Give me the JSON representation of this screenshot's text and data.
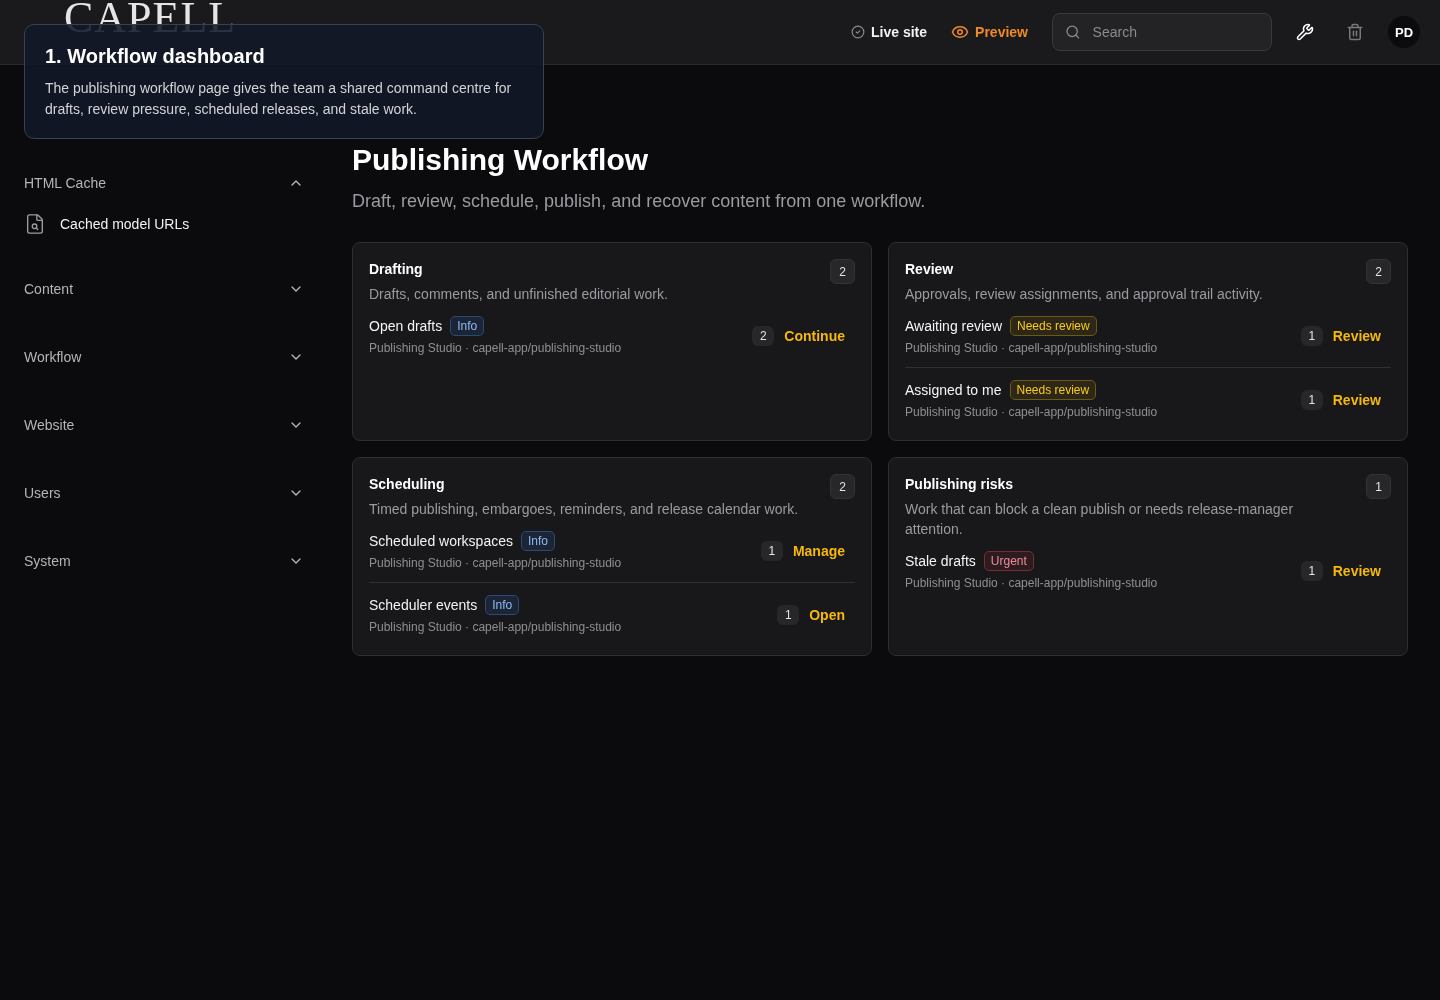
{
  "header": {
    "logo": "CAPELL",
    "live_site": "Live site",
    "preview": "Preview",
    "search": {
      "placeholder": "Search"
    },
    "avatar": "PD"
  },
  "tooltip": {
    "title": "1. Workflow dashboard",
    "body": "The publishing workflow page gives the team a shared command centre for drafts, review pressure, scheduled releases, and stale work."
  },
  "sidebar": {
    "groups": [
      {
        "label": "HTML Cache",
        "expanded": true,
        "children": [
          {
            "label": "Cached model URLs"
          }
        ]
      },
      {
        "label": "Content",
        "expanded": false
      },
      {
        "label": "Workflow",
        "expanded": false
      },
      {
        "label": "Website",
        "expanded": false
      },
      {
        "label": "Users",
        "expanded": false
      },
      {
        "label": "System",
        "expanded": false
      }
    ]
  },
  "page": {
    "title": "Publishing Workflow",
    "subtitle": "Draft, review, schedule, publish, and recover content from one workflow."
  },
  "cards": [
    {
      "title": "Drafting",
      "count": "2",
      "description": "Drafts, comments, and unfinished editorial work.",
      "items": [
        {
          "title": "Open drafts",
          "tag": {
            "label": "Info",
            "kind": "info"
          },
          "meta": "Publishing Studio · capell-app/publishing-studio",
          "count": "2",
          "action": "Continue"
        }
      ]
    },
    {
      "title": "Review",
      "count": "2",
      "description": "Approvals, review assignments, and approval trail activity.",
      "items": [
        {
          "title": "Awaiting review",
          "tag": {
            "label": "Needs review",
            "kind": "warning"
          },
          "meta": "Publishing Studio · capell-app/publishing-studio",
          "count": "1",
          "action": "Review"
        },
        {
          "title": "Assigned to me",
          "tag": {
            "label": "Needs review",
            "kind": "warning"
          },
          "meta": "Publishing Studio · capell-app/publishing-studio",
          "count": "1",
          "action": "Review"
        }
      ]
    },
    {
      "title": "Scheduling",
      "count": "2",
      "description": "Timed publishing, embargoes, reminders, and release calendar work.",
      "items": [
        {
          "title": "Scheduled workspaces",
          "tag": {
            "label": "Info",
            "kind": "info"
          },
          "meta": "Publishing Studio · capell-app/publishing-studio",
          "count": "1",
          "action": "Manage"
        },
        {
          "title": "Scheduler events",
          "tag": {
            "label": "Info",
            "kind": "info"
          },
          "meta": "Publishing Studio · capell-app/publishing-studio",
          "count": "1",
          "action": "Open"
        }
      ]
    },
    {
      "title": "Publishing risks",
      "count": "1",
      "description": "Work that can block a clean publish or needs release-manager attention.",
      "items": [
        {
          "title": "Stale drafts",
          "tag": {
            "label": "Urgent",
            "kind": "danger"
          },
          "meta": "Publishing Studio · capell-app/publishing-studio",
          "count": "1",
          "action": "Review"
        }
      ]
    }
  ]
}
